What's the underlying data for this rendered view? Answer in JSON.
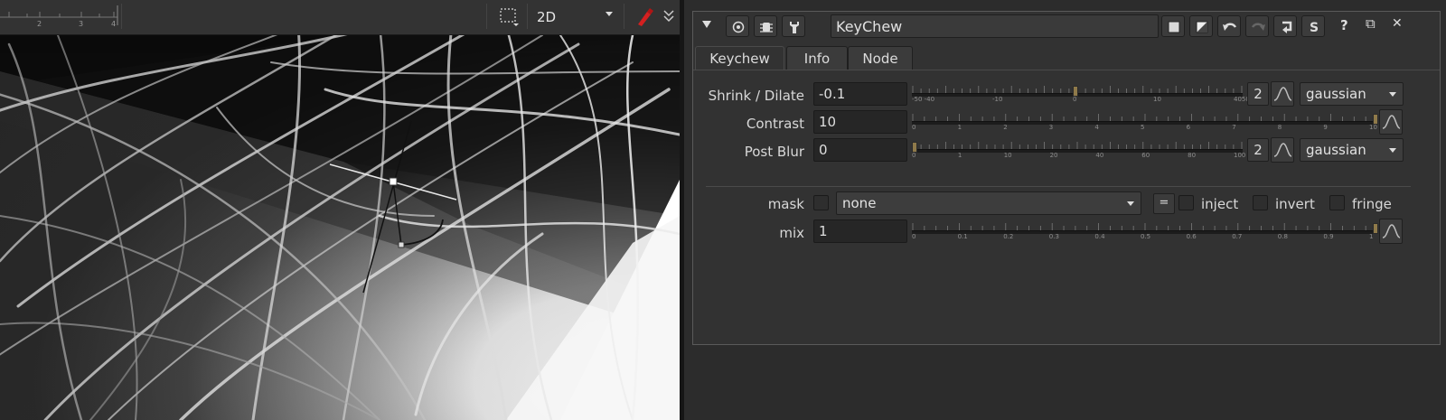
{
  "viewer": {
    "ruler_labels": [
      "2",
      "3",
      "4"
    ],
    "view_mode": "2D"
  },
  "node": {
    "name": "KeyChew",
    "tabs": [
      "Keychew",
      "Info",
      "Node"
    ],
    "active_tab": "Keychew",
    "header_right_glyphs": {
      "help": "?",
      "float": "⧉",
      "close": "✕"
    }
  },
  "params": {
    "shrink": {
      "label": "Shrink / Dilate",
      "value": "-0.1",
      "slider_labels": [
        "-50 -40",
        "-10",
        "0",
        "10",
        "4050"
      ],
      "slider_level": 0.495,
      "channels": "2",
      "filter": "gaussian"
    },
    "contrast": {
      "label": "Contrast",
      "value": "10",
      "slider_labels": [
        "0",
        "1",
        "2",
        "3",
        "4",
        "5",
        "6",
        "7",
        "8",
        "9",
        "10"
      ],
      "slider_level": 1.0
    },
    "postblur": {
      "label": "Post Blur",
      "value": "0",
      "slider_labels": [
        "0",
        "1",
        "10",
        "20",
        "40",
        "60",
        "80",
        "100"
      ],
      "slider_level": 0.0,
      "channels": "2",
      "filter": "gaussian"
    },
    "mask": {
      "label": "mask",
      "value": "none",
      "eq_symbol": "=",
      "inject": "inject",
      "invert": "invert",
      "fringe": "fringe"
    },
    "mix": {
      "label": "mix",
      "value": "1",
      "slider_labels": [
        "0",
        "0.1",
        "0.2",
        "0.3",
        "0.4",
        "0.5",
        "0.6",
        "0.7",
        "0.8",
        "0.9",
        "1"
      ],
      "slider_level": 1.0
    }
  },
  "colors": {
    "panel_bg": "#323232",
    "slider_handle": "#8f7a4a",
    "paint_accent": "#d42020"
  }
}
